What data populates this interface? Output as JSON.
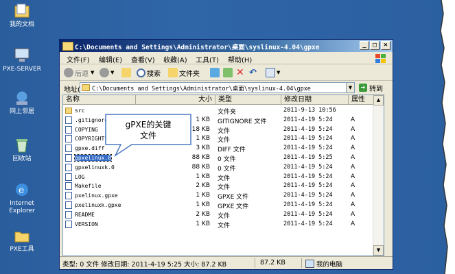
{
  "desktop_icons": [
    {
      "label": "我的文档",
      "icon": "my-documents-icon"
    },
    {
      "label": "PXE-SERVER",
      "icon": "computer-icon"
    },
    {
      "label": "网上邻居",
      "icon": "network-places-icon"
    },
    {
      "label": "回收站",
      "icon": "recycle-bin-icon"
    },
    {
      "label": "Internet",
      "label2": "Explorer",
      "icon": "internet-explorer-icon"
    },
    {
      "label": "PXE工具",
      "icon": "folder-icon"
    }
  ],
  "window": {
    "title": "C:\\Documents and Settings\\Administrator\\桌面\\syslinux-4.04\\gpxe",
    "menu": [
      "文件(F)",
      "编辑(E)",
      "查看(V)",
      "收藏(A)",
      "工具(T)",
      "帮助(H)"
    ],
    "toolbar": {
      "back": "后退",
      "search": "搜索",
      "folders": "文件夹"
    },
    "address": {
      "label": "地址(D)",
      "value": "C:\\Documents and Settings\\Administrator\\桌面\\syslinux-4.04\\gpxe",
      "go": "转到"
    },
    "columns": {
      "name": "名称",
      "size": "大小",
      "type": "类型",
      "date": "修改日期",
      "attr": "属性"
    },
    "files": [
      {
        "name": "src",
        "size": "",
        "type": "文件夹",
        "date": "2011-9-13 10:56",
        "attr": "",
        "folder": true
      },
      {
        "name": ".gitignore",
        "size": "1 KB",
        "type": "GITIGNORE 文件",
        "date": "2011-4-19 5:24",
        "attr": "A"
      },
      {
        "name": "COPYING",
        "size": "18 KB",
        "type": "文件",
        "date": "2011-4-19 5:24",
        "attr": "A"
      },
      {
        "name": "COPYRIGHTS",
        "size": "1 KB",
        "type": "文件",
        "date": "2011-4-19 5:24",
        "attr": "A"
      },
      {
        "name": "gpxe.diff",
        "size": "3 KB",
        "type": "DIFF 文件",
        "date": "2011-4-19 5:24",
        "attr": "A"
      },
      {
        "name": "gpxelinux.0",
        "size": "88 KB",
        "type": "0 文件",
        "date": "2011-4-19 5:25",
        "attr": "A",
        "selected": true
      },
      {
        "name": "gpxelinuxk.0",
        "size": "88 KB",
        "type": "0 文件",
        "date": "2011-4-19 5:24",
        "attr": "A"
      },
      {
        "name": "LOG",
        "size": "1 KB",
        "type": "文件",
        "date": "2011-4-19 5:24",
        "attr": "A"
      },
      {
        "name": "Makefile",
        "size": "2 KB",
        "type": "文件",
        "date": "2011-4-19 5:24",
        "attr": "A"
      },
      {
        "name": "pxelinux.gpxe",
        "size": "1 KB",
        "type": "GPXE 文件",
        "date": "2011-4-19 5:24",
        "attr": "A"
      },
      {
        "name": "pxelinuxk.gpxe",
        "size": "1 KB",
        "type": "GPXE 文件",
        "date": "2011-4-19 5:24",
        "attr": "A"
      },
      {
        "name": "README",
        "size": "2 KB",
        "type": "文件",
        "date": "2011-4-19 5:24",
        "attr": "A"
      },
      {
        "name": "VERSION",
        "size": "1 KB",
        "type": "文件",
        "date": "2011-4-19 5:24",
        "attr": "A"
      }
    ],
    "status": {
      "info": "类型: 0 文件 修改日期: 2011-4-19 5:25 大小: 87.2 KB",
      "size": "87.2 KB",
      "zone": "我的电脑"
    }
  },
  "callout": {
    "line1": "gPXE的关键",
    "line2": "文件"
  }
}
